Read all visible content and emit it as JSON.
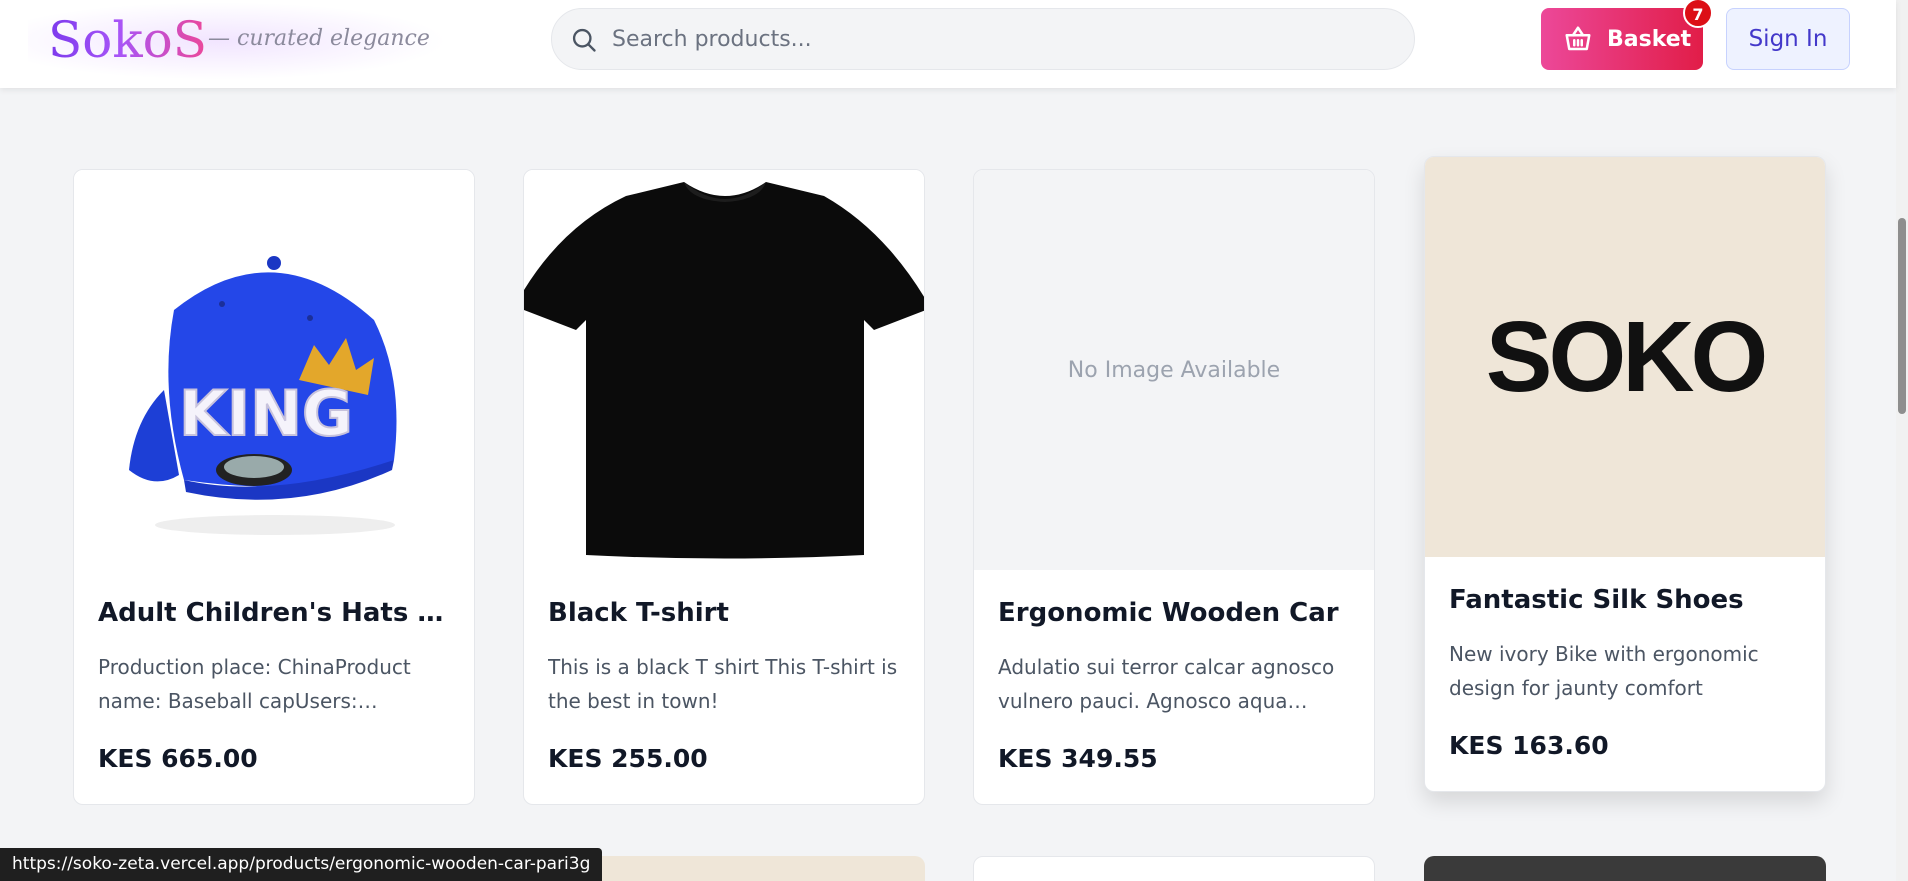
{
  "header": {
    "logo": "SokoS",
    "tagline": "— curated elegance",
    "search_placeholder": "Search products...",
    "basket_label": "Basket",
    "basket_count": "7",
    "signin_label": "Sign In"
  },
  "products": [
    {
      "title": "Adult Children's Hats Boys ...",
      "description": "Production place: ChinaProduct name: Baseball capUsers: ChildrenU...",
      "price": "KES 665.00",
      "cap_text": "KING",
      "image_icon": "cap-image"
    },
    {
      "title": "Black T-shirt",
      "description": "This is a black T shirt This T-shirt is the best in town!",
      "price": "KES 255.00",
      "image_icon": "tshirt-image"
    },
    {
      "title": "Ergonomic Wooden Car",
      "description": "Adulatio sui terror calcar agnosco vulnero pauci. Agnosco aqua repella...",
      "price": "KES 349.55",
      "no_image_text": "No Image Available"
    },
    {
      "title": "Fantastic Silk Shoes",
      "description": "New ivory Bike with ergonomic design for jaunty comfort",
      "price": "KES 163.60",
      "image_text": "SOKO"
    }
  ],
  "status_bar": {
    "url": "https://soko-zeta.vercel.app/products/ergonomic-wooden-car-pari3g"
  },
  "colors": {
    "accent_pink": "#ec4899",
    "accent_purple": "#7c3aed",
    "badge_red": "#dc0f16",
    "background": "#f3f4f6"
  }
}
